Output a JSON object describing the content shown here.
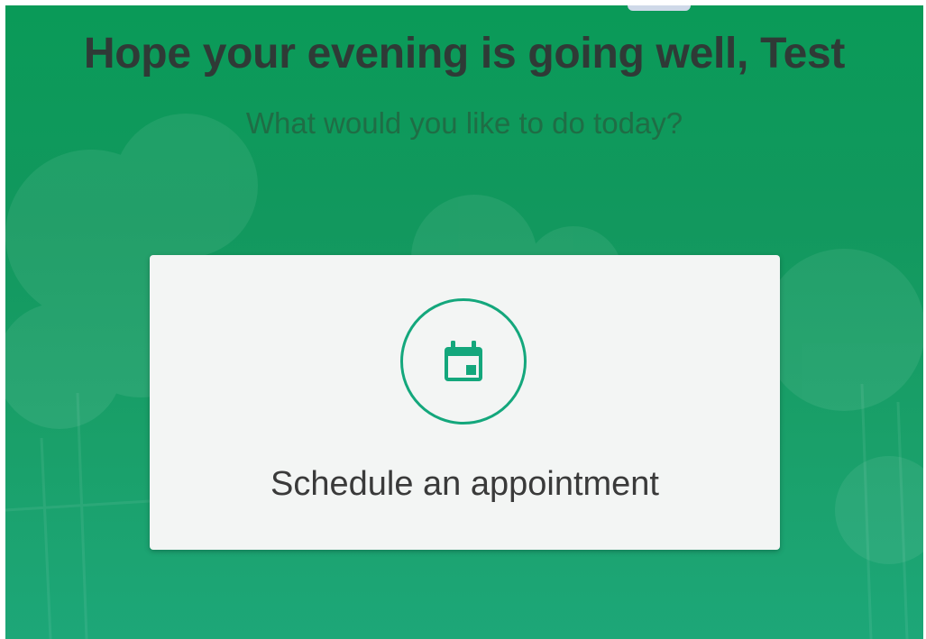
{
  "greeting": {
    "title": "Hope your evening is going well, Test",
    "subtitle": "What would you like to do today?"
  },
  "actions": [
    {
      "label": "Schedule an appointment",
      "icon": "calendar-icon"
    }
  ],
  "colors": {
    "background_green": "#0a9a58",
    "accent_teal": "#14a77c",
    "title_text": "#2f3a36",
    "subtitle_text": "#1f6d45",
    "card_bg": "#f3f5f4"
  }
}
